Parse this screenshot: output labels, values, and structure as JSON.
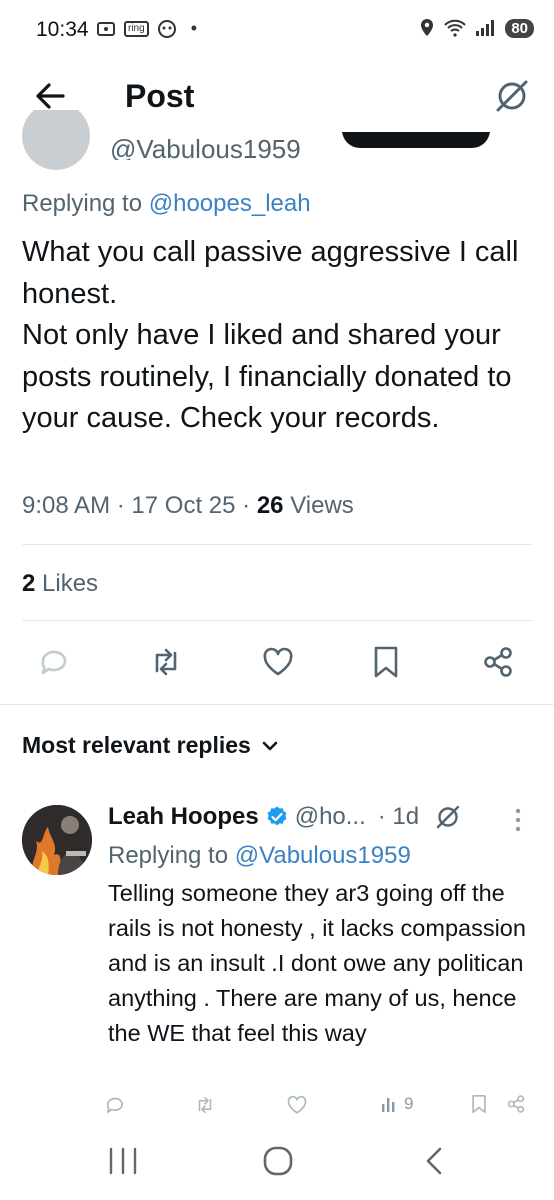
{
  "status_bar": {
    "time": "10:34",
    "ring_label": "ring",
    "battery": "80"
  },
  "header": {
    "title": "Post"
  },
  "clipped_row": {
    "handle": "@Vabulous1959"
  },
  "post": {
    "replying_prefix": "Replying to",
    "replying_handle": "@hoopes_leah",
    "text": "What you call passive aggressive I call honest.\nNot only have I liked and shared your posts routinely, I financially donated to your cause. Check your records.",
    "time": "9:08 AM",
    "date": "17 Oct 25",
    "views_count": "26",
    "views_label": "Views",
    "likes_count": "2",
    "likes_label": "Likes",
    "separator": "·"
  },
  "replies_section": {
    "title": "Most relevant replies"
  },
  "reply": {
    "name": "Leah Hoopes",
    "handle": "@ho...",
    "age": "· 1d",
    "replying_prefix": "Replying to",
    "replying_handle": "@Vabulous1959",
    "text": "Telling someone they ar3 going off the rails is not honesty , it lacks compassion and is an insult .I dont owe any politican anything . There are many of us, hence the WE that feel this way",
    "views": "9"
  },
  "colors": {
    "link": "#3b82c4",
    "muted": "#536471",
    "verified": "#1d9bf0"
  },
  "icons": [
    "back-arrow-icon",
    "grok-icon",
    "reply-icon",
    "repost-icon",
    "like-icon",
    "bookmark-icon",
    "share-icon",
    "more-icon",
    "verified-icon",
    "views-icon"
  ]
}
